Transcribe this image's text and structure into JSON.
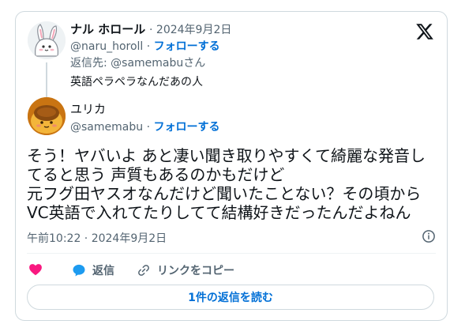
{
  "parent": {
    "name": "ナル ホロール",
    "date": "· 2024年9月2日",
    "handle": "@naru_horoll",
    "dot": "·",
    "follow": "フォローする",
    "reply_to_label": "返信先: ",
    "reply_to_handle": "@samemabu",
    "reply_to_suffix": "さん",
    "text": "英語ペラペラなんだあの人"
  },
  "reply": {
    "name": "ユリカ",
    "handle": "@samemabu",
    "dot": "·",
    "follow": "フォローする",
    "text_lines": [
      "そう！ヤバいよ あと凄い聞き取りやすくて綺麗な発音し",
      "てると思う 声質もあるのかもだけど",
      "元フグ田ヤスオなんだけど聞いたことない？その頃から",
      "VC英語で入れてたりしてて結構好きだったんだよねん"
    ],
    "timestamp": "午前10:22 · 2024年9月2日"
  },
  "actions": {
    "reply_label": "返信",
    "copy_link_label": "リンクをコピー"
  },
  "read_replies_label": "1件の返信を読む",
  "icons": {
    "brand": "x-logo-icon",
    "like": "heart-icon",
    "reply": "speech-bubble-icon",
    "copy": "link-icon",
    "info": "info-icon"
  },
  "colors": {
    "text": "#0f1419",
    "muted": "#536471",
    "link": "#006fd6",
    "like": "#f91880",
    "reply_bubble": "#1d9bf0",
    "border": "#cfd9de"
  }
}
